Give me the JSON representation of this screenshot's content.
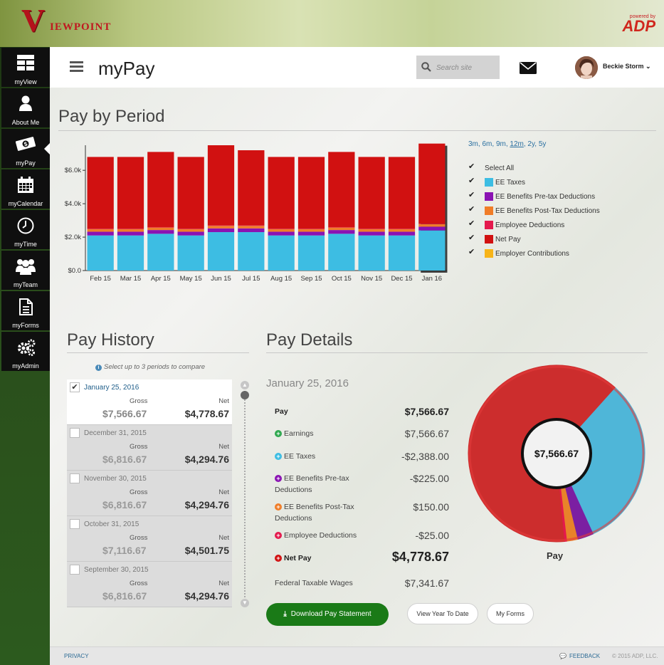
{
  "brand": {
    "logo_letter": "V",
    "logo_word": "IEWPOINT",
    "powered_by": "powered by",
    "adp": "ADP"
  },
  "sidebar": {
    "items": [
      {
        "label": "myView",
        "icon": "dashboard-icon"
      },
      {
        "label": "About Me",
        "icon": "person-icon"
      },
      {
        "label": "myPay",
        "icon": "money-icon"
      },
      {
        "label": "myCalendar",
        "icon": "calendar-icon"
      },
      {
        "label": "myTime",
        "icon": "clock-icon"
      },
      {
        "label": "myTeam",
        "icon": "team-icon"
      },
      {
        "label": "myForms",
        "icon": "document-icon"
      },
      {
        "label": "myAdmin",
        "icon": "gears-icon"
      }
    ],
    "active": "myPay"
  },
  "header": {
    "title": "myPay",
    "search_placeholder": "Search site",
    "user_name": "Beckie Storm",
    "user_caret": "⌄"
  },
  "pay_by_period": {
    "title": "Pay by Period",
    "ranges": [
      "3m",
      "6m",
      "9m",
      "12m",
      "2y",
      "5y"
    ],
    "selected_range": "12m",
    "legend": {
      "select_all": "Select All",
      "items": [
        {
          "label": "EE Taxes",
          "color": "#3dbde3"
        },
        {
          "label": "EE Benefits Pre-tax Deductions",
          "color": "#8a12b3"
        },
        {
          "label": "EE Benefits Post-Tax Deductions",
          "color": "#f07d28"
        },
        {
          "label": "Employee Deductions",
          "color": "#e4194d"
        },
        {
          "label": "Net Pay",
          "color": "#d11111"
        },
        {
          "label": "Employer Contributions",
          "color": "#f7b419"
        }
      ]
    }
  },
  "chart_data": {
    "type": "bar",
    "stacked": true,
    "categories": [
      "Feb 15",
      "Mar 15",
      "Apr 15",
      "May 15",
      "Jun 15",
      "Jul 15",
      "Aug 15",
      "Sep 15",
      "Oct 15",
      "Nov 15",
      "Dec 15",
      "Jan 16"
    ],
    "ylim": [
      0,
      7500
    ],
    "yticks": [
      0,
      2000,
      4000,
      6000
    ],
    "ytick_labels": [
      "$0.0",
      "$2.0k",
      "$4.0k",
      "$6.0k"
    ],
    "series": [
      {
        "name": "EE Taxes",
        "color": "#3dbde3",
        "values": [
          2100,
          2100,
          2200,
          2100,
          2300,
          2300,
          2100,
          2100,
          2200,
          2100,
          2100,
          2400
        ]
      },
      {
        "name": "EE Benefits Pre-tax Deductions",
        "color": "#8a12b3",
        "values": [
          225,
          225,
          225,
          225,
          225,
          225,
          225,
          225,
          225,
          225,
          225,
          225
        ]
      },
      {
        "name": "EE Benefits Post-Tax Deductions",
        "color": "#f07d28",
        "values": [
          150,
          150,
          150,
          150,
          150,
          150,
          150,
          150,
          150,
          150,
          150,
          150
        ]
      },
      {
        "name": "Employee Deductions",
        "color": "#e4194d",
        "values": [
          25,
          25,
          25,
          25,
          25,
          25,
          25,
          25,
          25,
          25,
          25,
          25
        ]
      },
      {
        "name": "Net Pay",
        "color": "#d11111",
        "values": [
          4300,
          4300,
          4500,
          4300,
          4800,
          4500,
          4300,
          4300,
          4500,
          4300,
          4300,
          4800
        ]
      }
    ],
    "highlighted_category": "Jan 16"
  },
  "pay_history": {
    "title": "Pay History",
    "hint": "Select up to 3 periods to compare",
    "gross_label": "Gross",
    "net_label": "Net",
    "items": [
      {
        "date": "January 25, 2016",
        "gross": "$7,566.67",
        "net": "$4,778.67",
        "selected": true
      },
      {
        "date": "December 31, 2015",
        "gross": "$6,816.67",
        "net": "$4,294.76",
        "selected": false
      },
      {
        "date": "November 30, 2015",
        "gross": "$6,816.67",
        "net": "$4,294.76",
        "selected": false
      },
      {
        "date": "October 31, 2015",
        "gross": "$7,116.67",
        "net": "$4,501.75",
        "selected": false
      },
      {
        "date": "September 30, 2015",
        "gross": "$6,816.67",
        "net": "$4,294.76",
        "selected": false
      }
    ]
  },
  "pay_details": {
    "title": "Pay Details",
    "date": "January 25, 2016",
    "rows": [
      {
        "label": "Pay",
        "value": "$7,566.67"
      },
      {
        "label": "Earnings",
        "value": "$7,566.67",
        "icon_color": "#2fa84f"
      },
      {
        "label": "EE Taxes",
        "value": "-$2,388.00",
        "icon_color": "#3dbde3"
      },
      {
        "label": "EE Benefits Pre-tax Deductions",
        "value": "-$225.00",
        "icon_color": "#8a12b3"
      },
      {
        "label": "EE Benefits Post-Tax Deductions",
        "value": "$150.00",
        "icon_color": "#f07d28"
      },
      {
        "label": "Employee Deductions",
        "value": "-$25.00",
        "icon_color": "#e4194d"
      },
      {
        "label": "Net Pay",
        "value": "$4,778.67",
        "icon_color": "#d11111"
      },
      {
        "label": "Federal Taxable Wages",
        "value": "$7,341.67"
      }
    ],
    "donut_center": "$7,566.67",
    "donut_label": "Pay",
    "donut_slices": [
      {
        "name": "Net Pay",
        "value": 4778.67,
        "color": "#cc2d2d"
      },
      {
        "name": "EE Taxes",
        "value": 2388.0,
        "color": "#4fb6d8"
      },
      {
        "name": "EE Benefits Pre-tax Deductions",
        "value": 225.0,
        "color": "#7b1fa2"
      },
      {
        "name": "EE Benefits Post-Tax Deductions",
        "value": 150.0,
        "color": "#e8832a"
      },
      {
        "name": "Employee Deductions",
        "value": 25.0,
        "color": "#e4194d"
      }
    ],
    "buttons": {
      "download": "Download Pay Statement",
      "year_to_date": "View Year To Date",
      "my_forms": "My Forms"
    }
  },
  "footer": {
    "privacy": "PRIVACY",
    "feedback": "FEEDBACK",
    "copyright": "© 2015 ADP, LLC."
  }
}
